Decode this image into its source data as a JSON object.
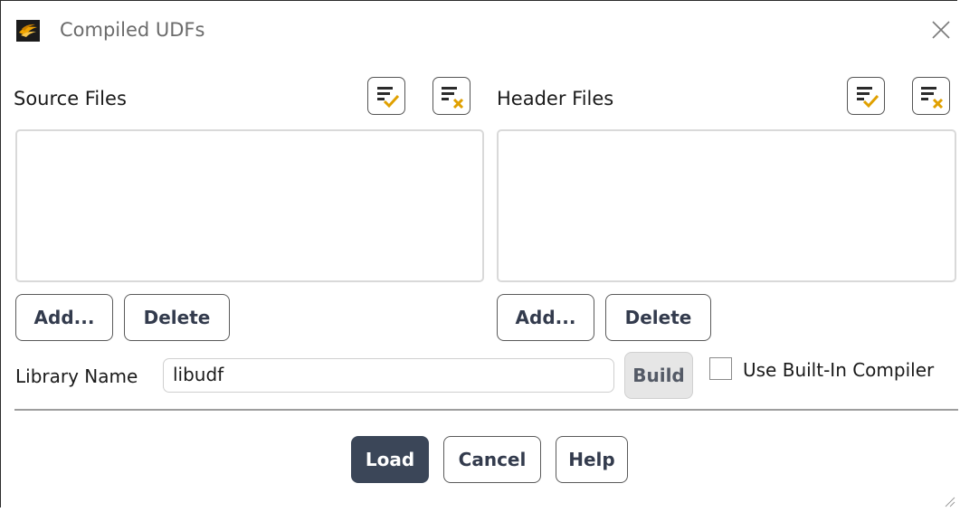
{
  "window": {
    "title": "Compiled UDFs"
  },
  "source": {
    "label": "Source Files",
    "items": [],
    "add_label": "Add...",
    "delete_label": "Delete"
  },
  "header": {
    "label": "Header Files",
    "items": [],
    "add_label": "Add...",
    "delete_label": "Delete"
  },
  "library": {
    "label": "Library Name",
    "value": "libudf",
    "build_label": "Build"
  },
  "compiler": {
    "checkbox_label": "Use Built-In Compiler",
    "checked": false
  },
  "footer": {
    "load_label": "Load",
    "cancel_label": "Cancel",
    "help_label": "Help"
  },
  "icons": {
    "app": "ansys-app-icon",
    "close": "close-icon",
    "select_all": "select-all-icon",
    "deselect_all": "deselect-all-icon"
  },
  "colors": {
    "primary_button": "#3b4658",
    "check_accent": "#e0a000",
    "x_accent": "#e0a000"
  }
}
